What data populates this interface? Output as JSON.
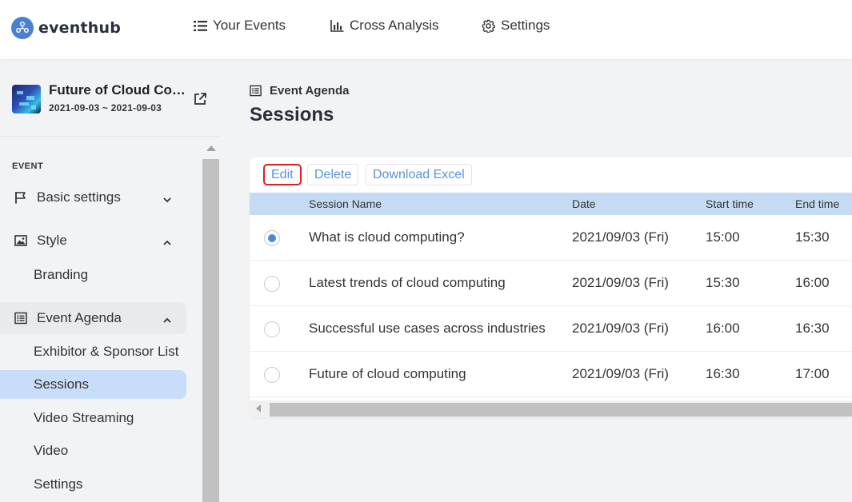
{
  "header": {
    "logo_text": "eventhub",
    "nav": [
      {
        "label": "Your Events",
        "icon": "list-icon"
      },
      {
        "label": "Cross Analysis",
        "icon": "bar-chart-icon"
      },
      {
        "label": "Settings",
        "icon": "gear-icon"
      }
    ]
  },
  "event": {
    "title": "Future of Cloud Computing",
    "dates": "2021-09-03 ~ 2021-09-03"
  },
  "sidebar": {
    "section_label": "EVENT",
    "groups": [
      {
        "label": "Basic settings",
        "icon": "flag-icon",
        "expanded": false
      },
      {
        "label": "Style",
        "icon": "image-icon",
        "expanded": true,
        "items": [
          "Branding"
        ]
      },
      {
        "label": "Event Agenda",
        "icon": "list-icon",
        "expanded": true,
        "items": [
          "Exhibitor & Sponsor List",
          "Sessions",
          "Video Streaming",
          "Video",
          "Settings"
        ],
        "active_item": "Sessions"
      }
    ]
  },
  "main": {
    "breadcrumb": "Event Agenda",
    "title": "Sessions",
    "toolbar": {
      "edit": "Edit",
      "delete": "Delete",
      "download": "Download Excel"
    },
    "columns": [
      "Session Name",
      "Date",
      "Start time",
      "End time"
    ],
    "rows": [
      {
        "name": "What is cloud computing?",
        "date": "2021/09/03 (Fri)",
        "start": "15:00",
        "end": "15:30",
        "selected": true
      },
      {
        "name": "Latest trends of cloud computing",
        "date": "2021/09/03 (Fri)",
        "start": "15:30",
        "end": "16:00",
        "selected": false
      },
      {
        "name": "Successful use cases across industries",
        "date": "2021/09/03 (Fri)",
        "start": "16:00",
        "end": "16:30",
        "selected": false
      },
      {
        "name": "Future of cloud computing",
        "date": "2021/09/03 (Fri)",
        "start": "16:30",
        "end": "17:00",
        "selected": false
      }
    ]
  },
  "colors": {
    "brand": "#4a7fd6",
    "active_item_bg": "#c8ddf8",
    "table_header_bg": "#c4dbf3",
    "link_button": "#5a93d6",
    "focus_outline": "#d9211f"
  }
}
